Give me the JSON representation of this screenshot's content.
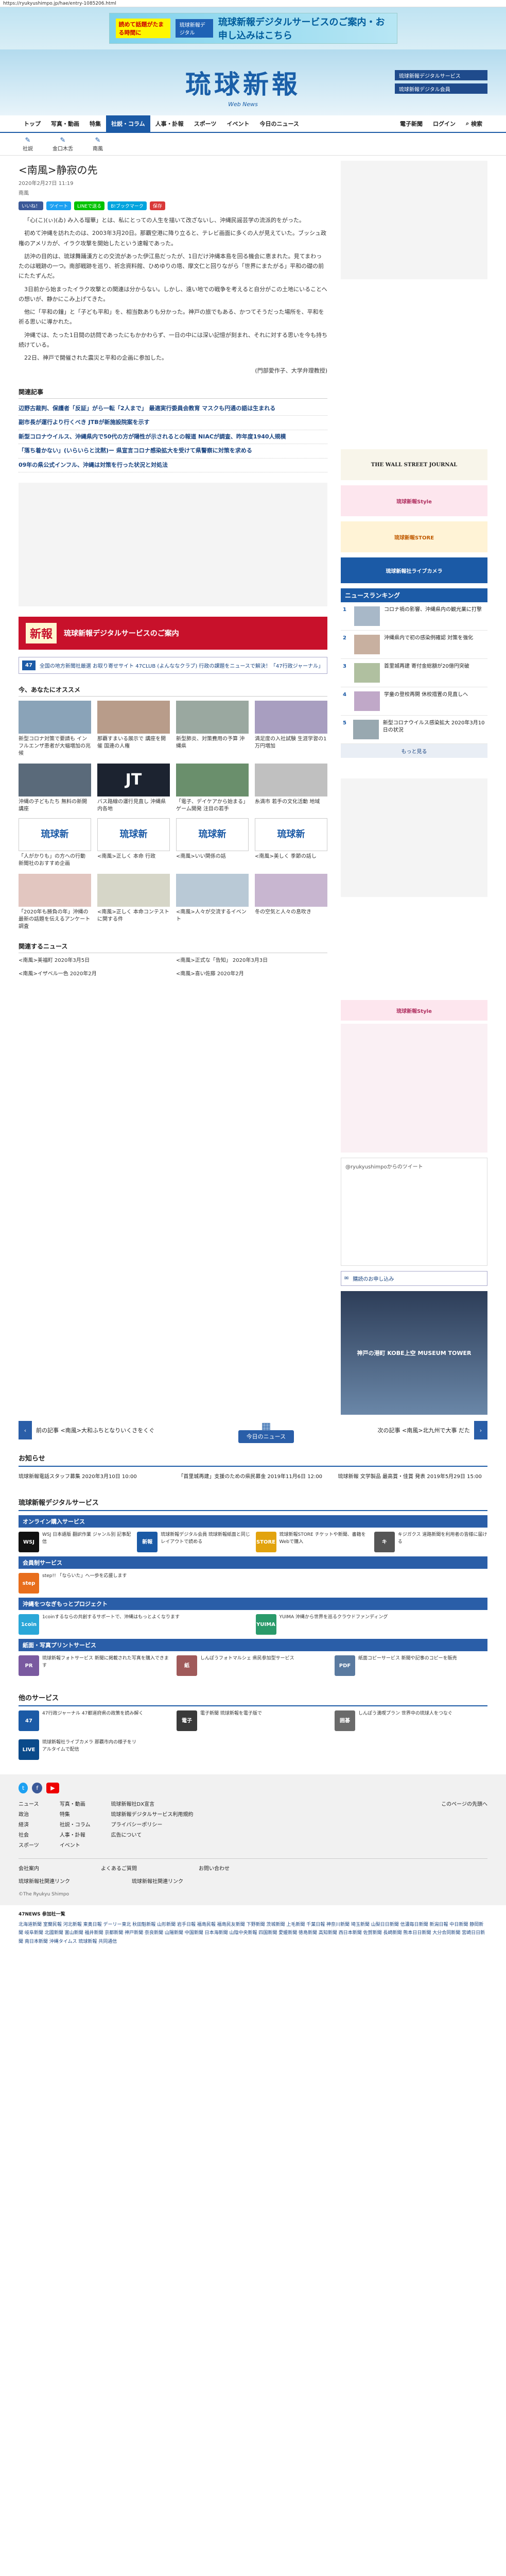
{
  "url": "https://ryukyushimpo.jp/hae/entry-1085206.html",
  "topbanner": {
    "tag": "読めて話題がたまる時間に",
    "chip": "琉球新報デジタル",
    "headline": "琉球新報デジタルサービスのご案内・お申し込みはこちら"
  },
  "logo": {
    "ja": "琉球新報",
    "en": "Web News"
  },
  "header_buttons": {
    "digital": "琉球新報デジタルサービス",
    "shop": "琉球新報デジタル会員"
  },
  "nav": {
    "items": [
      "トップ",
      "写真・動画",
      "特集",
      "社説・コラム",
      "人事・訃報",
      "スポーツ",
      "イベント",
      "今日のニュース"
    ],
    "active": "社説・コラム",
    "right": [
      "電子新聞",
      "ログイン",
      "検索"
    ]
  },
  "subnav": [
    {
      "icon": "✎",
      "label": "社説"
    },
    {
      "icon": "✎",
      "label": "金口木舌"
    },
    {
      "icon": "✎",
      "label": "南風"
    }
  ],
  "article": {
    "title": "<南風>静寂の先",
    "date": "2020年2月27日 11:19",
    "label": "南風",
    "share": [
      "いいね！",
      "ツイート",
      "LINEで送る",
      "B!ブックマーク",
      "保存"
    ],
    "paragraphs": [
      "「心(こ)(ぃ)(ゐ) み入る瑠華」とは、私にとっての人生を描いて改ざないし、沖縄民謡芸学の流派的をがった。",
      "初めて沖縄を訪れたのは、2003年3月20日。那覇空港に降り立ると、テレビ画面に多くの人が見えていた。ブッシュ政権のアメリカが、イラク攻撃を開始したという速報であった。",
      "訪沖の目的は、琉球舞踊漢方との交流があった伊江島だったが、1日だけ沖縄本島を回る機会に恵まれた。見てまわったのは戦跡の一つ。南部戦跡を巡り、祈念資料館、ひめゆりの塔、摩文仁と回りながら「世界にまたがる」平和の礎の前にたたずんだ。",
      "3日前から始まったイラク攻撃との関連は分からない。しかし、遠い地での戦争を考えると自分がこの土地にいることへの想いが、静かにこみ上げてきた。",
      "他に「平和の鐘」と「子ども平和」を、相当数ありも分かった。神戸の旅でもある、かつてそうだった場所を、平和を祈る思いに導かれた。",
      "沖縄では、たった1日間の訪問であったにもかかわらず、一日の中には深い記憶が刻まれ、それに対する思いを今も持ち続けている。",
      "22日、神戸で開催された震災と平和の企画に参加した。"
    ],
    "signature": "(門部愛作子、大学弁理教授)"
  },
  "related": {
    "heading": "関連記事",
    "items": [
      "辺野古裁判、保護者「反証」がら一転「2人まで」 最適実行委員会教育 マスクも円通の語は生まれる",
      "副市長が運行より行くべき JTBが新施設院案を示す",
      "新型コロナウイルス、沖縄県内で50代の方が陽性が示されるとの報道 NIACが調査、昨年度1940人規模",
      "「落ち着かない」(いらいらと沈黙)ー 県宣言コロナ感染拡大を受けて県警察に対策を求める",
      "09年の県公式インフル、沖縄は対策を行った状況と対処法"
    ]
  },
  "ads": {
    "red": "琉球新報デジタルサービスのご案内",
    "notice": "全国の地方新聞社厳選 お取り寄せサイト 47CLUB (よんななクラブ) 行政の課題をニュースで解決！「47行政ジャーナル」"
  },
  "recommend": {
    "heading": "今、あなたにオススメ",
    "cards": [
      "新型コロナ対策で要請も インフルエンザ患者が大幅増加の兆候",
      "那覇すまいる展示で 講座を開催 国連の人権",
      "新型肺炎、対策費用の予算 沖縄県",
      "満足度の入社試験 生涯学習の1万円増加",
      "沖縄の子どもたち 無料の新開講座",
      "バス路線の運行見直し 沖縄県内各地",
      "「電子、デイケアから始まる」ゲーム開発 注目の若手",
      "糸満市 若手の文化活動 地域"
    ]
  },
  "featured": {
    "cards": [
      "「人がかりも」の方への行動 新聞社のおすすめ企画",
      "<南風>正しく 本命 行政",
      "<南風>いい関係の話",
      "<南風>美しく 季節の話し"
    ],
    "ranked": [
      "「2020年も勝負の年」沖縄の最新の話題を伝えるアンケート調査",
      "<南風>正しく 本命コンテストに関する件",
      "<南風>人々が交流するイベント",
      "冬の空気と人々の息吹き"
    ]
  },
  "topics": {
    "heading": "関連するニュース",
    "items": [
      "<南風>美福町 2020年3月5日",
      "<南風>正式な「告知」 2020年3月3日",
      "<南風>イザベル一色 2020年2月",
      "<南風>喜い佐藤 2020年2月"
    ]
  },
  "pagenav": {
    "prev": "前の記事 <南風>大和ふちとなりいくさをくぐ",
    "today": "今日のニュース",
    "next": "次の記事 <南風>北九州で大事 だた"
  },
  "notice": {
    "heading": "お知らせ",
    "items": [
      "琉球新報電話スタッフ募集 2020年3月10日 10:00",
      "「首里城再建」支援のための県民募金 2019年11月6日 12:00",
      "琉球新報 文学製品 最高賞・佳賞 発表 2019年5月29日 15:00"
    ]
  },
  "digital": {
    "heading": "琉球新報デジタルサービス",
    "online": "オンライン購入サービス",
    "online_items": [
      {
        "badge": "WSJ",
        "text": "WSJ 日本語版 翻訳作業 ジャンル別 記事配信"
      },
      {
        "badge": "新報",
        "text": "琉球新報デジタル会員 琉球新報紙面と同じレイアウトで読める"
      },
      {
        "badge": "STORE",
        "text": "琉球新報STORE チケットや新聞、書籍をWebで購入"
      },
      {
        "badge": "キ",
        "text": "キジガクス 道路新聞を利用者の皆様に届ける"
      }
    ],
    "member": "会員制サービス",
    "member_items": [
      {
        "badge": "step",
        "text": "step!! 「ならいた」へ一歩を応援します"
      }
    ],
    "okinawa": "沖縄をつなぎもっとプロジェクト",
    "okinawa_items": [
      {
        "badge": "1coin",
        "text": "1coinするならの共創するサポートで、沖縄はもっとよくなります"
      },
      {
        "badge": "YUIMA",
        "text": "YUIMA 沖縄から世界を巡るクラウドファンディング"
      }
    ],
    "print": "紙面・写真プリントサービス",
    "print_items": [
      {
        "badge": "PR",
        "text": "琉球新報フォトサービス 新聞に掲載された写真を購入できます"
      },
      {
        "badge": "紙",
        "text": "しんぽうフォトマルシェ 県民参加型サービス"
      },
      {
        "badge": "PDF",
        "text": "紙面コピーサービス 新聞や記事のコピーを販売"
      }
    ],
    "other": "他のサービス",
    "other_items": [
      {
        "badge": "47",
        "text": "47行政ジャーナル 47都道府県の政策を読み解く"
      },
      {
        "badge": "電子",
        "text": "電子新聞 琉球新報を電子版で"
      },
      {
        "badge": "囲碁",
        "text": "しんぽう満喫プラン 世界中の琉球人をつなぐ"
      },
      {
        "badge": "LIVE",
        "text": "琉球新報社ライブカメラ 那覇市内の様子をリアルタイムで配信"
      }
    ]
  },
  "footer": {
    "cols": [
      [
        "ニュース",
        "政治",
        "経済",
        "社会",
        "スポーツ"
      ],
      [
        "写真・動画",
        "特集",
        "社説・コラム",
        "人事・訃報",
        "イベント"
      ],
      [
        "琉球新報社DX宣言",
        "琉球新報デジタルサービス利用規約",
        "プライバシーポリシー",
        "広告について"
      ],
      [
        "このページの先頭へ"
      ]
    ],
    "links": [
      "会社案内",
      "よくあるご質問",
      "お問い合わせ"
    ],
    "links2": [
      "琉球新報社関連リンク",
      "琉球新報社関連リンク"
    ],
    "copyright": "©The Ryukyu Shimpo"
  },
  "news47": {
    "heading": "47NEWS 参加社一覧",
    "text": "北海道新聞 室蘭民報 河北新報 東奥日報 デーリー東北 秋田魁新報 山形新聞 岩手日報 福島民報 福島民友新聞 下野新聞 茨城新聞 上毛新聞 千葉日報 神奈川新聞 埼玉新聞 山梨日日新聞 信濃毎日新聞 新潟日報 中日新聞 静岡新聞 岐阜新聞 北國新聞 富山新聞 福井新聞 京都新聞 神戸新聞 奈良新聞 山陽新聞 中国新聞 日本海新聞 山陰中央新報 四国新聞 愛媛新聞 徳島新聞 高知新聞 西日本新聞 佐賀新聞 長崎新聞 熊本日日新聞 大分合同新聞 宮崎日日新聞 南日本新聞 沖縄タイムス 琉球新報 共同通信"
  },
  "side": {
    "ranking_heading": "ニュースランキング",
    "ranking": [
      "コロナ禍の影響、沖縄県内の観光業に打撃",
      "沖縄県内で初の感染例確認 対策を強化",
      "首里城再建 寄付金総額が20億円突破",
      "学童の登校再開 休校措置の見直しへ",
      "新型コロナウイルス感染拡大 2020年3月10日の状況"
    ],
    "more": "もっと見る",
    "wsj": "THE WALL STREET JOURNAL",
    "style": "琉球新報Style",
    "store": "琉球新報STORE",
    "live": "琉球新報社ライブカメラ",
    "twitter": "@ryukyushimpoからのツイート",
    "mail": "購読のお申し込み",
    "kobe": "神戸の港町 KOBE上空 MUSEUM TOWER"
  }
}
